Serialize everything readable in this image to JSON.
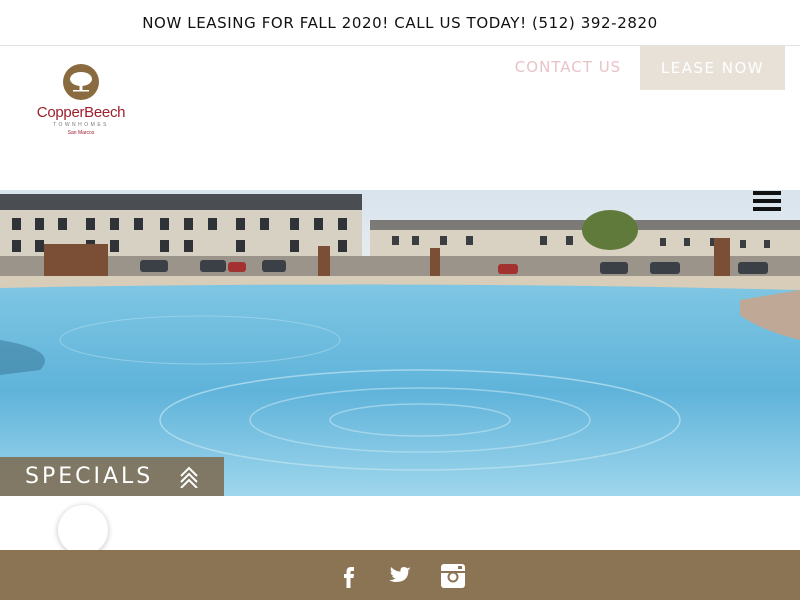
{
  "announcement": {
    "text": "NOW LEASING FOR FALL 2020! CALL US TODAY! (512) 392-2820"
  },
  "logo": {
    "name": "CopperBeech",
    "tagline": "TOWNHOMES",
    "city": "San Marcos"
  },
  "nav": {
    "contact_label": "CONTACT US",
    "lease_label": "LEASE NOW"
  },
  "hero": {
    "image": "pool-and-townhomes-photo"
  },
  "specials": {
    "label": "SPECIALS",
    "icon": "double-chevron-up-icon"
  },
  "footer": {
    "social": [
      "facebook-icon",
      "twitter-icon",
      "instagram-icon"
    ]
  },
  "colors": {
    "brand_brown": "#8b7454",
    "brand_red": "#9c1f2e",
    "lease_button": "#e7e1d8",
    "contact_link": "#e8c3c8"
  }
}
